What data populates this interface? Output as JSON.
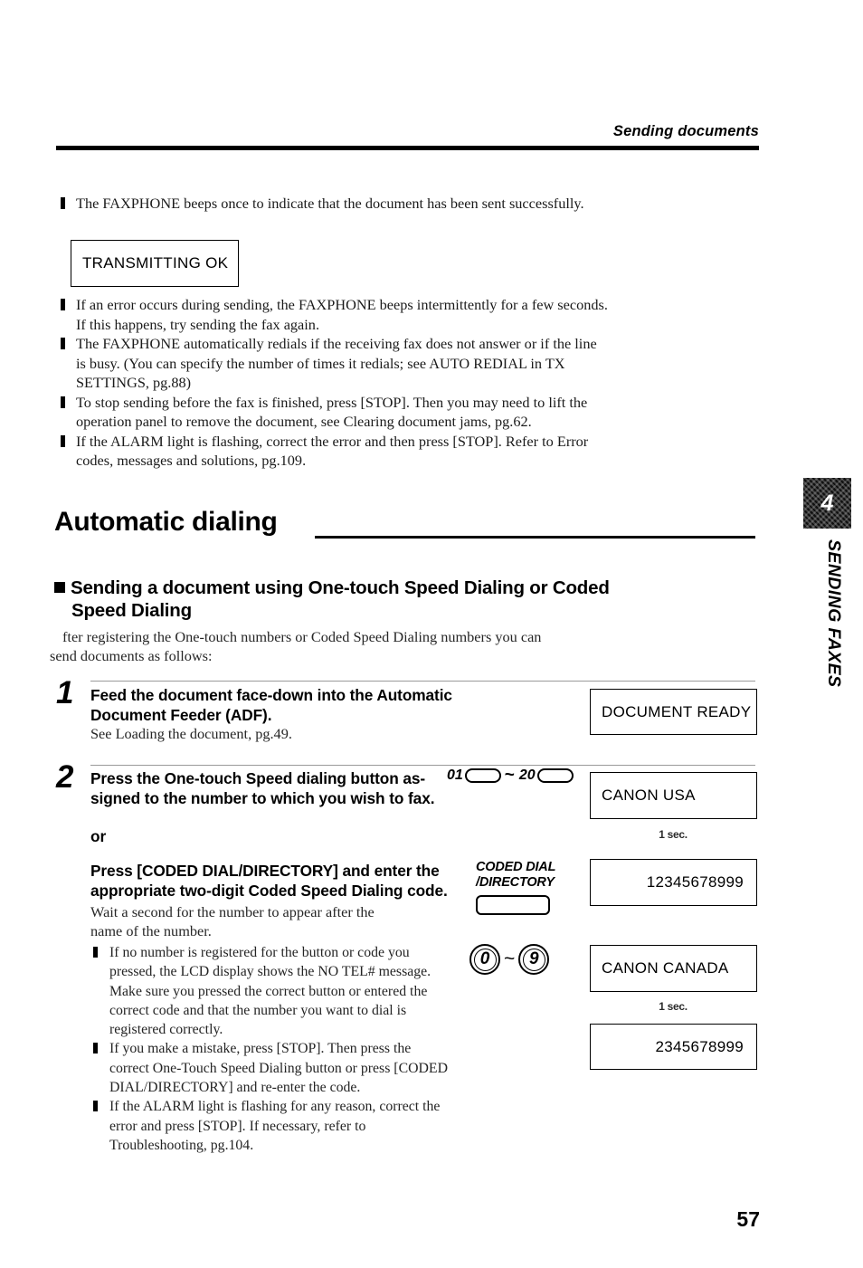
{
  "header": {
    "title": "Sending documents"
  },
  "top_notes": [
    "The FAXPHONE beeps once to indicate that the document has been sent successfully."
  ],
  "lcd_transmitting": "TRANSMITTING OK",
  "notes": [
    "If an error occurs during sending, the FAXPHONE beeps intermittently for a few seconds.  If this happens, try sending the fax again.",
    "The FAXPHONE automatically redials if the receiving fax does not answer or if the line is busy. (You can specify the number of times it redials; see AUTO REDIAL in TX SETTINGS, pg.88)",
    "To stop sending before the fax is finished, press [STOP].  Then you may need to lift the operation panel to remove the document, see Clearing document jams, pg.62.",
    "If the ALARM light is flashing, correct the error and then press [STOP].  Refer to Error codes, messages and solutions, pg.109."
  ],
  "section": {
    "title": "Automatic dialing",
    "subtitle_line1": "Sending a document using One-touch Speed Dialing or Coded",
    "subtitle_line2": "Speed Dialing",
    "intro_line1": "fter registering the One-touch numbers or Coded Speed Dialing numbers you can",
    "intro_line2": "send documents as follows:"
  },
  "steps": [
    {
      "number": "1",
      "head_line1": "Feed the document face-down into the Automatic",
      "head_line2": "Document Feeder (ADF).",
      "sub": "See Loading the document, pg.49."
    },
    {
      "number": "2",
      "head_line1": "Press the One-touch Speed dialing button as-",
      "head_line2": "signed to the number to which you wish to fax.",
      "or_label": "or",
      "alt_head_line1": "Press [CODED DIAL/DIRECTORY] and enter the",
      "alt_head_line2": "appropriate two-digit Coded Speed Dialing code.",
      "alt_sub_line1": "Wait a second for the number to appear after the",
      "alt_sub_line2": "name of the number."
    }
  ],
  "keys": {
    "onetouch_first": "01",
    "onetouch_tilde": "~",
    "onetouch_last": "20",
    "coded_label_line1": "CODED DIAL",
    "coded_label_line2": "/DIRECTORY",
    "numkey_first": "0",
    "numkey_tilde": "~",
    "numkey_last": "9"
  },
  "displays": {
    "document_ready": "DOCUMENT READY",
    "canon_usa": "CANON USA",
    "usa_number": "12345678999",
    "canon_canada": "CANON CANADA",
    "canada_number": "2345678999",
    "delay_label_1": "1 sec.",
    "delay_label_2": "1 sec."
  },
  "step2_notes": [
    "If no number is registered for the button or code you pressed, the LCD display shows the NO TEL# message.  Make sure you pressed the correct button or entered the correct code and that the number you want to dial is registered correctly.",
    "If you make a mistake, press [STOP].  Then press the correct One-Touch Speed Dialing button or press [CODED DIAL/DIRECTORY] and re-enter the code.",
    "If the ALARM light is flashing for any reason, correct the error and press [STOP].  If necessary, refer to Troubleshooting, pg.104."
  ],
  "chapter_tab": {
    "number": "4",
    "label": "SENDING FAXES"
  },
  "footer": {
    "page_number": "57"
  }
}
